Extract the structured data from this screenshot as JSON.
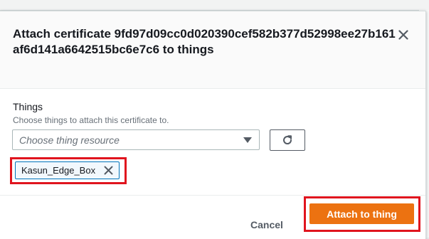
{
  "dialog": {
    "title": "Attach certificate 9fd97d09cc0d020390cef582b377d52998ee27b161af6d141a6642515bc6e7c6 to things",
    "close_icon": "close-icon"
  },
  "things_field": {
    "label": "Things",
    "description": "Choose things to attach this certificate to.",
    "select_placeholder": "Choose thing resource",
    "caret_icon": "caret-down-icon",
    "refresh_icon": "refresh-icon",
    "selected_tokens": [
      {
        "label": "Kasun_Edge_Box",
        "dismiss_icon": "close-icon"
      }
    ]
  },
  "footer": {
    "cancel_label": "Cancel",
    "primary_label": "Attach to thing"
  },
  "colors": {
    "primary": "#ec7211",
    "highlight": "#e0141e",
    "token_border": "#0073bb",
    "token_bg": "#f2f8fd"
  }
}
